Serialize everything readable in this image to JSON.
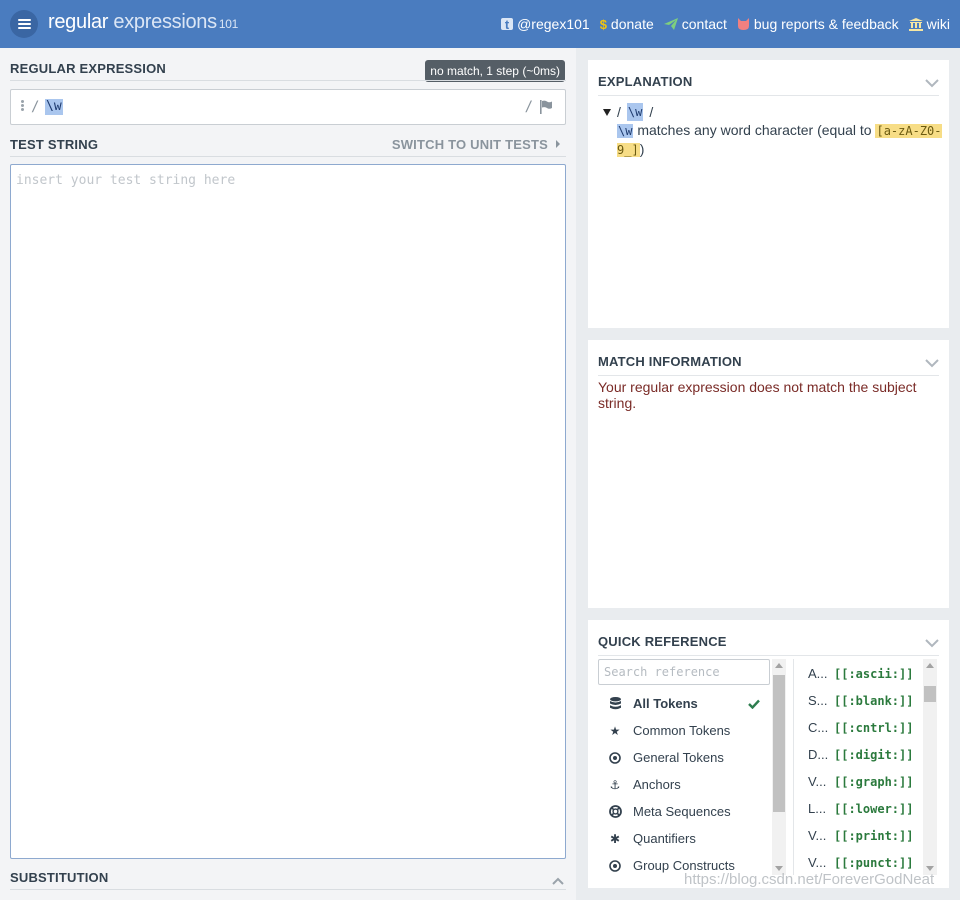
{
  "header": {
    "logo_part1": "regular",
    "logo_part2": " expressions",
    "logo_part3": "101",
    "nav": [
      {
        "label": "@regex101",
        "icon": "twitter-icon"
      },
      {
        "label": "donate",
        "icon": "dollar-icon"
      },
      {
        "label": "contact",
        "icon": "paper-plane-icon"
      },
      {
        "label": "bug reports & feedback",
        "icon": "github-icon"
      },
      {
        "label": "wiki",
        "icon": "bank-icon"
      }
    ]
  },
  "regex": {
    "title": "REGULAR EXPRESSION",
    "status": "no match, 1 step (~0ms)",
    "delim_open": "/",
    "delim_close": "/",
    "value": "\\w"
  },
  "test": {
    "title": "TEST STRING",
    "switch_label": "SWITCH TO UNIT TESTS",
    "placeholder": "insert your test string here",
    "value": ""
  },
  "substitution": {
    "title": "SUBSTITUTION"
  },
  "explanation": {
    "title": "EXPLANATION",
    "slash_open": "/",
    "token": "\\w",
    "slash_close": "/",
    "desc_token": "\\w",
    "desc_text": " matches any word character (equal to ",
    "desc_class": "[a-zA-Z0-9_]",
    "desc_end": ")"
  },
  "match_info": {
    "title": "MATCH INFORMATION",
    "message": "Your regular expression does not match the subject string."
  },
  "quick_reference": {
    "title": "QUICK REFERENCE",
    "search_placeholder": "Search reference",
    "categories": [
      {
        "label": "All Tokens",
        "icon": "database-icon",
        "active": true
      },
      {
        "label": "Common Tokens",
        "icon": "star-icon"
      },
      {
        "label": "General Tokens",
        "icon": "dot-circle-icon"
      },
      {
        "label": "Anchors",
        "icon": "anchor-icon"
      },
      {
        "label": "Meta Sequences",
        "icon": "lifebuoy-icon"
      },
      {
        "label": "Quantifiers",
        "icon": "asterisk-icon"
      },
      {
        "label": "Group Constructs",
        "icon": "dot-circle-icon"
      }
    ],
    "tokens": [
      {
        "short": "A...",
        "code": "[[:ascii:]]"
      },
      {
        "short": "S...",
        "code": "[[:blank:]]"
      },
      {
        "short": "C...",
        "code": "[[:cntrl:]]"
      },
      {
        "short": "D...",
        "code": "[[:digit:]]"
      },
      {
        "short": "V...",
        "code": "[[:graph:]]"
      },
      {
        "short": "L...",
        "code": "[[:lower:]]"
      },
      {
        "short": "V...",
        "code": "[[:print:]]"
      },
      {
        "short": "V...",
        "code": "[[:punct:]]"
      }
    ]
  },
  "watermark": "https://blog.csdn.net/ForeverGodNeat",
  "colors": {
    "header": "#4a7cbf",
    "accent_token": "#aac6ee",
    "class_token": "#f7dd86",
    "match_message": "#7a2b27",
    "token_code": "#2b7a3d"
  }
}
